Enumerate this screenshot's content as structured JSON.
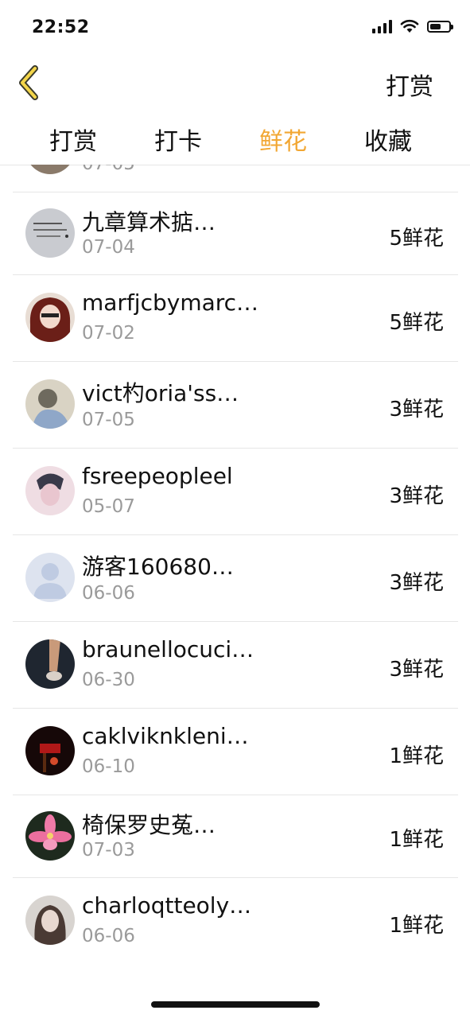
{
  "status_bar": {
    "time": "22:52"
  },
  "nav": {
    "action_label": "打赏"
  },
  "tabs": [
    {
      "label": "打赏",
      "active": false
    },
    {
      "label": "打卡",
      "active": false
    },
    {
      "label": "鲜花",
      "active": true
    },
    {
      "label": "收藏",
      "active": false
    }
  ],
  "accent_color": "#f2a733",
  "list": {
    "partial_date": "07-05",
    "rows": [
      {
        "name": "九章算术掂…",
        "date": "07-04",
        "amount": "5鲜花"
      },
      {
        "name": "marfjcbymarc…",
        "date": "07-02",
        "amount": "5鲜花"
      },
      {
        "name": "vict杓oria'ss…",
        "date": "07-05",
        "amount": "3鲜花"
      },
      {
        "name": "fsreepeopleel",
        "date": "05-07",
        "amount": "3鲜花"
      },
      {
        "name": "游客160680…",
        "date": "06-06",
        "amount": "3鲜花"
      },
      {
        "name": "braunellocuci…",
        "date": "06-30",
        "amount": "3鲜花"
      },
      {
        "name": "caklviknkleni…",
        "date": "06-10",
        "amount": "1鲜花"
      },
      {
        "name": "椅保罗史菟…",
        "date": "07-03",
        "amount": "1鲜花"
      },
      {
        "name": "charloqtteoly…",
        "date": "06-06",
        "amount": "1鲜花"
      }
    ]
  }
}
